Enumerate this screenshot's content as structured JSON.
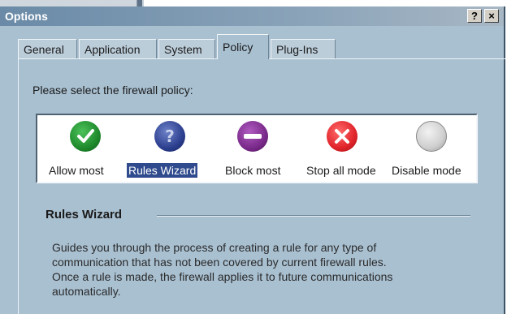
{
  "window": {
    "title": "Options",
    "help_label": "?",
    "close_label": "×"
  },
  "tabs": [
    {
      "label": "General"
    },
    {
      "label": "Application"
    },
    {
      "label": "System"
    },
    {
      "label": "Policy",
      "active": true
    },
    {
      "label": "Plug-Ins"
    }
  ],
  "policy": {
    "prompt": "Please select the firewall policy:",
    "selected": "Rules Wizard",
    "options": [
      {
        "label": "Allow most",
        "icon": "check-icon",
        "color": "#1f8a2c"
      },
      {
        "label": "Rules Wizard",
        "icon": "question-icon",
        "color": "#2c3f8f"
      },
      {
        "label": "Block most",
        "icon": "minus-icon",
        "color": "#7a2a8a"
      },
      {
        "label": "Stop all mode",
        "icon": "x-icon",
        "color": "#e0242a"
      },
      {
        "label": "Disable mode",
        "icon": "blank-circle-icon",
        "color": "#cfcfcf"
      }
    ]
  },
  "details": {
    "title": "Rules Wizard",
    "description_lines": [
      "Guides you through the process of creating a rule for any type of",
      "communication that has not been covered by current firewall rules.",
      "Once a rule is made, the firewall applies it to future communications",
      "automatically."
    ]
  }
}
